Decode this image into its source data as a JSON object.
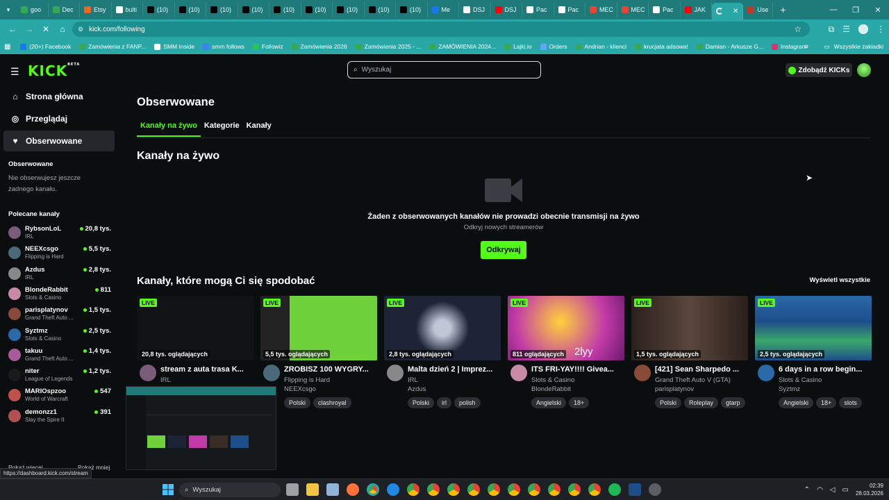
{
  "browser": {
    "tabs": [
      {
        "label": "goo",
        "fav": "chrome-sheet",
        "color": "#34a853"
      },
      {
        "label": "Dec",
        "fav": "chrome-sheet",
        "color": "#34a853"
      },
      {
        "label": "Etsy",
        "fav": "etsy",
        "color": "#f1641e"
      },
      {
        "label": "bulti",
        "fav": "globe",
        "color": "#ffffff"
      },
      {
        "label": "(10)",
        "fav": "tiktok",
        "color": "#000000"
      },
      {
        "label": "(10)",
        "fav": "tiktok",
        "color": "#000000"
      },
      {
        "label": "(10)",
        "fav": "tiktok",
        "color": "#000000"
      },
      {
        "label": "(10)",
        "fav": "tiktok",
        "color": "#000000"
      },
      {
        "label": "(10)",
        "fav": "tiktok",
        "color": "#000000"
      },
      {
        "label": "(10)",
        "fav": "tiktok",
        "color": "#000000"
      },
      {
        "label": "(10)",
        "fav": "tiktok",
        "color": "#000000"
      },
      {
        "label": "(10)",
        "fav": "tiktok",
        "color": "#000000"
      },
      {
        "label": "(10)",
        "fav": "tiktok",
        "color": "#000000"
      },
      {
        "label": "Me",
        "fav": "meta",
        "color": "#1877f2"
      },
      {
        "label": "DSJ",
        "fav": "google",
        "color": "#ffffff"
      },
      {
        "label": "DSJ",
        "fav": "youtube",
        "color": "#ff0000"
      },
      {
        "label": "Pac",
        "fav": "google",
        "color": "#ffffff"
      },
      {
        "label": "Pac",
        "fav": "google",
        "color": "#ffffff"
      },
      {
        "label": "MEC",
        "fav": "gmail",
        "color": "#ea4335"
      },
      {
        "label": "MEC",
        "fav": "gmail",
        "color": "#ea4335"
      },
      {
        "label": "Pac",
        "fav": "google",
        "color": "#ffffff"
      },
      {
        "label": "JAK",
        "fav": "youtube",
        "color": "#ff0000"
      }
    ],
    "active_tab": {
      "label": "",
      "fav": "kick-loading"
    },
    "next_tab": {
      "label": "Use",
      "fav": "flag"
    },
    "new_tab_symbol": "+",
    "url": "kick.com/following",
    "bookmarks": [
      {
        "label": "(20+) Facebook",
        "color": "#1877f2"
      },
      {
        "label": "Zamówienia z FANP...",
        "color": "#34a853"
      },
      {
        "label": "SMM Inside",
        "color": "#ffffff"
      },
      {
        "label": "smm follows",
        "color": "#3b82f6"
      },
      {
        "label": "Followiz",
        "color": "#22c55e"
      },
      {
        "label": "Zamówienia 2026",
        "color": "#34a853"
      },
      {
        "label": "Zamówienia 2025 - ...",
        "color": "#34a853"
      },
      {
        "label": "ZAMÓWIENIA 2024...",
        "color": "#34a853"
      },
      {
        "label": "Lajki.io",
        "color": "#34a853"
      },
      {
        "label": "Orders",
        "color": "#60a5fa"
      },
      {
        "label": "Andrian - klienci",
        "color": "#34a853"
      },
      {
        "label": "krucjata adsowa!",
        "color": "#34a853"
      },
      {
        "label": "Damian - Arkusze G...",
        "color": "#34a853"
      },
      {
        "label": "Instagram",
        "color": "#e1306c"
      }
    ],
    "bookmarks_more": "»",
    "all_bookmarks": "Wszystkie zakładki"
  },
  "kick": {
    "logo": "KICK",
    "logo_badge": "BETA",
    "search_placeholder": "Wyszukaj",
    "get_kicks": "Zdobądź KICKs",
    "nav": [
      {
        "label": "Strona główna",
        "icon": "home-icon",
        "glyph": "⌂"
      },
      {
        "label": "Przeglądaj",
        "icon": "compass-icon",
        "glyph": "◎"
      },
      {
        "label": "Obserwowane",
        "icon": "heart-icon",
        "glyph": "♥"
      }
    ],
    "followed_header": "Obserwowane",
    "followed_empty": "Nie obserwujesz jeszcze żadnego kanału.",
    "recommended_header": "Polecane kanały",
    "recommended": [
      {
        "name": "RybsonLoL",
        "category": "IRL",
        "viewers": "20,8 tys.",
        "color": "#7a5c7a"
      },
      {
        "name": "NEEXcsgo",
        "category": "Flipping is Hard",
        "viewers": "5,5 tys.",
        "color": "#4a6a7a"
      },
      {
        "name": "Azdus",
        "category": "IRL",
        "viewers": "2,8 tys.",
        "color": "#888888"
      },
      {
        "name": "BlondeRabbit",
        "category": "Slots & Casino",
        "viewers": "811",
        "color": "#c98aa8"
      },
      {
        "name": "parisplatynov",
        "category": "Grand Theft Auto ...",
        "viewers": "1,5 tys.",
        "color": "#8a4a3a"
      },
      {
        "name": "Syztmz",
        "category": "Slots & Casino",
        "viewers": "2,5 tys.",
        "color": "#2a6aa8"
      },
      {
        "name": "takuu",
        "category": "Grand Theft Auto ...",
        "viewers": "1,4 tys.",
        "color": "#a85a9a"
      },
      {
        "name": "niter",
        "category": "League of Legends",
        "viewers": "1,2 tys.",
        "color": "#1a1a1a"
      },
      {
        "name": "MARIOspzoo",
        "category": "World of Warcraft",
        "viewers": "547",
        "color": "#c0504a"
      },
      {
        "name": "demonzz1",
        "category": "Slay the Spire II",
        "viewers": "391",
        "color": "#b05050"
      }
    ],
    "show_more": "Pokaż więcej",
    "show_less": "Pokaż mniej",
    "page_title": "Obserwowane",
    "tabs": [
      "Kanały na żywo",
      "Kategorie",
      "Kanały"
    ],
    "live_section_title": "Kanały na żywo",
    "empty_title": "Żaden z obserwowanych kanałów nie prowadzi obecnie transmisji na żywo",
    "empty_sub": "Odkryj nowych streamerów",
    "discover_button": "Odkrywaj",
    "suggest_title": "Kanały, które mogą Ci się spodobać",
    "see_all": "Wyświetl wszystkie",
    "live_badge": "LIVE",
    "cards": [
      {
        "viewers": "20,8 tys. oglądających",
        "title": "stream z auta trasa K...",
        "category": "IRL",
        "channel": "",
        "tags": [],
        "thumb": "#111315",
        "avatar": "#7a5c7a"
      },
      {
        "viewers": "5,5 tys. oglądających",
        "title": "ZROBISZ 100 WYGRY...",
        "category": "Flipping is Hard",
        "channel": "NEEXcsgo",
        "tags": [
          "Polski",
          "clashroyal"
        ],
        "thumb": "#6fd23a",
        "avatar": "#4a6a7a"
      },
      {
        "viewers": "2,8 tys. oglądających",
        "title": "Malta dzień 2 | Imprez...",
        "category": "IRL",
        "channel": "Azdus",
        "tags": [
          "Polski",
          "irl",
          "polish"
        ],
        "thumb": "#1c2436",
        "avatar": "#888888"
      },
      {
        "viewers": "811 oglądających",
        "title": "ITS FRI-YAY!!!! Givea...",
        "category": "Slots & Casino",
        "channel": "BlondeRabbit",
        "tags": [
          "Angielski",
          "18+"
        ],
        "thumb": "#c23aa8",
        "avatar": "#c98aa8"
      },
      {
        "viewers": "1,5 tys. oglądających",
        "title": "[421] Sean Sharpedo ...",
        "category": "Grand Theft Auto V (GTA)",
        "channel": "parisplatynov",
        "tags": [
          "Polski",
          "Roleplay",
          "gtarp"
        ],
        "thumb": "#3a2c26",
        "avatar": "#8a4a3a"
      },
      {
        "viewers": "2,5 tys. oglądających",
        "title": "6 days in a row begin...",
        "category": "Slots & Casino",
        "channel": "Syztmz",
        "tags": [
          "Angielski",
          "18+",
          "slots"
        ],
        "thumb": "#1d4e8a",
        "avatar": "#2a6aa8"
      }
    ],
    "thumb_overlay_text": "2lyy",
    "status_url": "https://dashboard.kick.com/stream"
  },
  "taskbar": {
    "search": "Wyszukaj",
    "time": "02:39",
    "date": "28.03.2026"
  },
  "colors": {
    "accent": "#53fc18",
    "browser": "#2aa8a8"
  }
}
